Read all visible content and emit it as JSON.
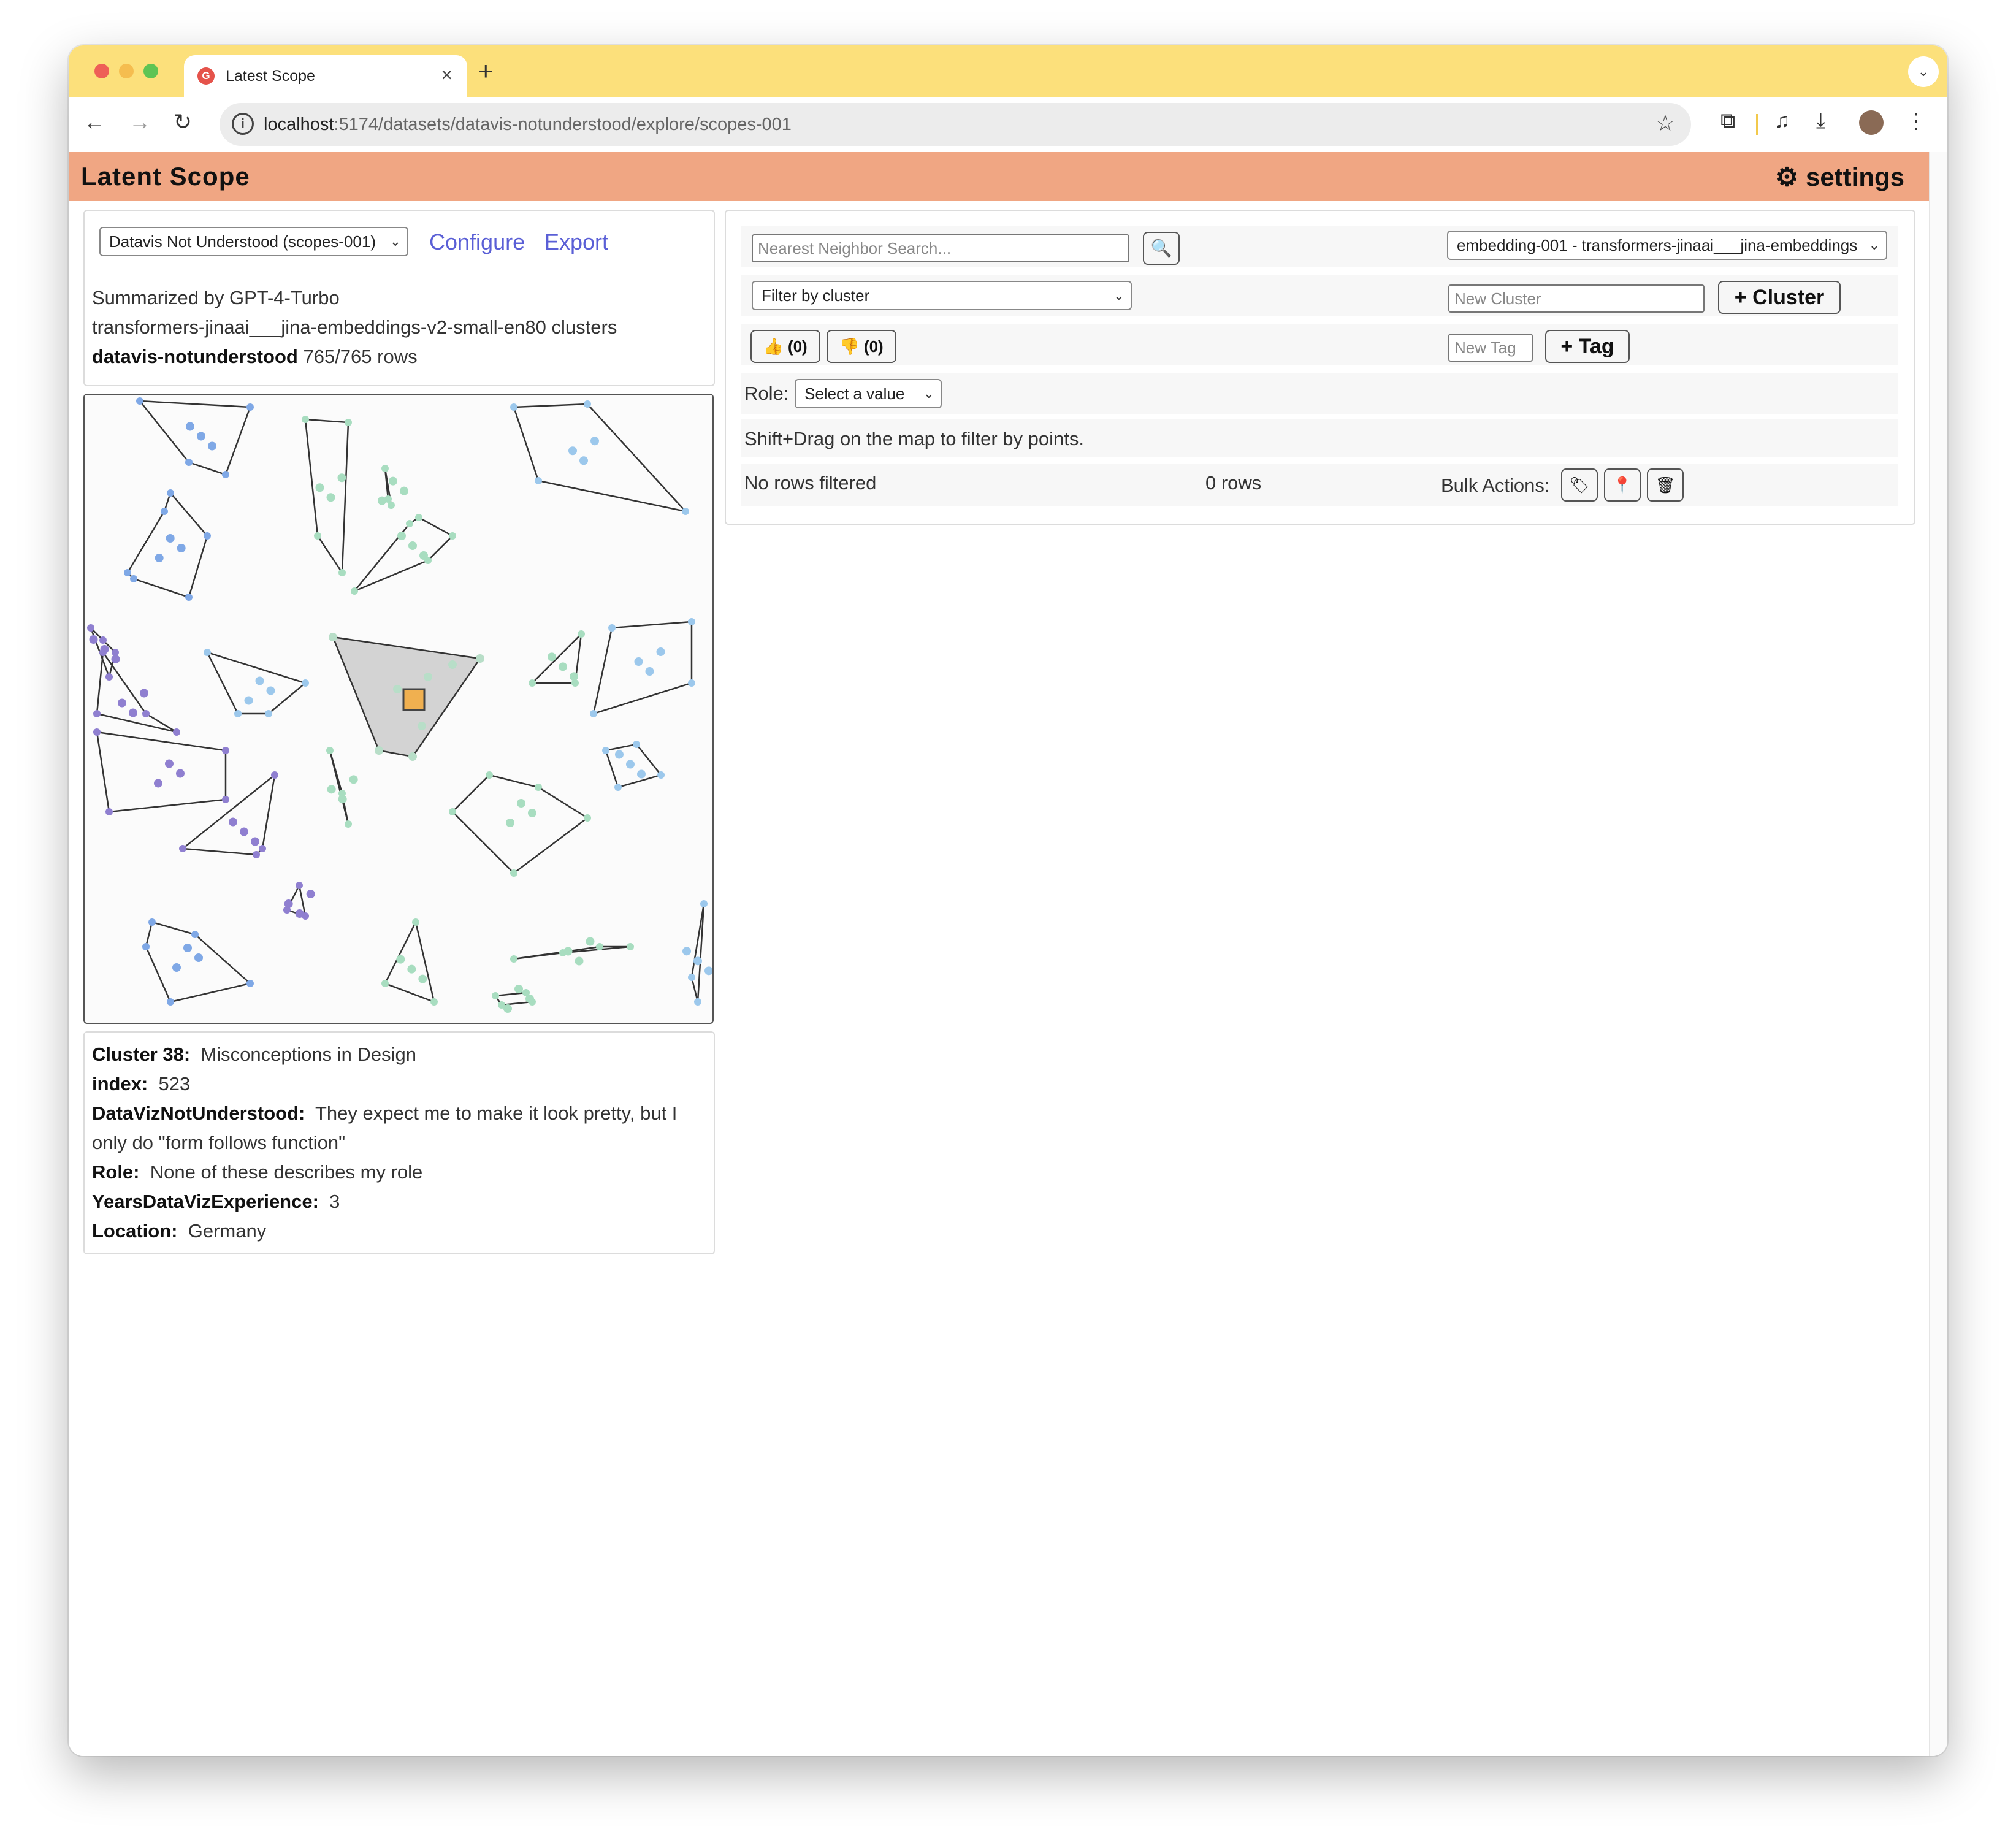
{
  "browser": {
    "tab_title": "Latest Scope",
    "tab_favicon": "G",
    "url_host": "localhost",
    "url_rest": ":5174/datasets/datavis-notunderstood/explore/scopes-001",
    "icons": [
      "back-icon",
      "forward-icon",
      "reload-icon",
      "info-icon",
      "star-icon",
      "extensions-icon",
      "media-icon",
      "download-icon",
      "menu-icon"
    ]
  },
  "app": {
    "title": "Latent Scope",
    "settings_label": "⚙ settings"
  },
  "left": {
    "scope_select": "Datavis Not Understood (scopes-001)",
    "configure": "Configure",
    "export": "Export",
    "summary_line1": "Summarized by GPT-4-Turbo",
    "summary_line2": "transformers-jinaai___jina-embeddings-v2-small-en80 clusters",
    "dataset_name": "datavis-notunderstood",
    "dataset_rows": "765/765 rows"
  },
  "detail": {
    "cluster_label": "Cluster 38:",
    "cluster_value": "Misconceptions in Design",
    "index_label": "index:",
    "index_value": "523",
    "field_label": "DataVizNotUnderstood:",
    "field_value_line1": "They expect me to make it look pretty, but I",
    "field_value_line2": "only do \"form follows function\"",
    "role_label": "Role:",
    "role_value": "None of these describes my role",
    "years_label": "YearsDataVizExperience:",
    "years_value": "3",
    "location_label": "Location:",
    "location_value": "Germany"
  },
  "right": {
    "nn_placeholder": "Nearest Neighbor Search...",
    "embedding_select": "embedding-001 - transformers-jinaai___jina-embeddings",
    "filter_cluster": "Filter by cluster",
    "new_cluster_placeholder": "New Cluster",
    "add_cluster": "+ Cluster",
    "thumbs_up": "👍 (0)",
    "thumbs_down": "👎 (0)",
    "new_tag_placeholder": "New Tag",
    "add_tag": "+ Tag",
    "role_label": "Role:",
    "role_select": "Select a value",
    "hint": "Shift+Drag on the map to filter by points.",
    "no_rows": "No rows filtered",
    "rows_count": "0 rows",
    "bulk_actions": "Bulk Actions:"
  },
  "colors": {
    "tabstrip": "#fce07b",
    "appbar": "#f0a683",
    "link": "#5a5fd6",
    "selected_point": "#f0b050"
  }
}
